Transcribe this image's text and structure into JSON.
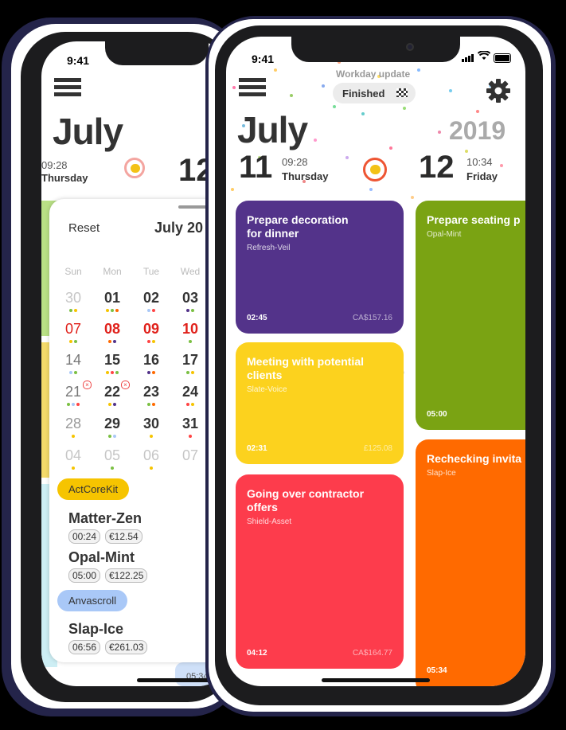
{
  "back_phone": {
    "status_time": "9:41",
    "month": "July",
    "left_time": "09:28",
    "left_weekday": "Thursday",
    "right_day": "12",
    "sheet": {
      "reset_label": "Reset",
      "month_label": "July 20",
      "weekdays": [
        "Sun",
        "Mon",
        "Tue",
        "Wed"
      ],
      "rows": [
        [
          "30",
          "01",
          "02",
          "03"
        ],
        [
          "07",
          "08",
          "09",
          "10"
        ],
        [
          "14",
          "15",
          "16",
          "17"
        ],
        [
          "21",
          "22",
          "23",
          "24"
        ],
        [
          "28",
          "29",
          "30",
          "31"
        ],
        [
          "04",
          "05",
          "06",
          "07"
        ]
      ],
      "groups": [
        {
          "name": "ActCoreKit",
          "color": "#f6c400",
          "items": [
            {
              "name": "Matter-Zen",
              "duration": "00:24",
              "amount": "€12.54"
            },
            {
              "name": "Opal-Mint",
              "duration": "05:00",
              "amount": "€122.25"
            }
          ]
        },
        {
          "name": "Anvascroll",
          "color": "#a9c8f7",
          "items": [
            {
              "name": "Slap-Ice",
              "duration": "06:56",
              "amount": "€261.03"
            }
          ]
        }
      ],
      "peek_time": "05:34"
    }
  },
  "front_phone": {
    "status_time": "9:41",
    "update_label": "Workday update",
    "finished_label": "Finished",
    "month": "July",
    "year": "2019",
    "left_day": "11",
    "left_time": "09:28",
    "left_weekday": "Thursday",
    "right_day": "12",
    "right_time": "10:34",
    "right_weekday": "Friday",
    "cards_left": [
      {
        "title": "Prepare decoration for dinner",
        "subtitle": "Refresh-Veil",
        "duration": "02:45",
        "amount": "CA$157.16",
        "color": "#53338a"
      },
      {
        "title": "Meeting with potential clients",
        "subtitle": "Slate-Voice",
        "duration": "02:31",
        "amount": "£125.08",
        "color": "#fcd21e"
      },
      {
        "title": "Going over contractor offers",
        "subtitle": "Shield-Asset",
        "duration": "04:12",
        "amount": "CA$164.77",
        "color": "#fd3c4c"
      }
    ],
    "cards_right": [
      {
        "title": "Prepare seating p",
        "subtitle": "Opal-Mint",
        "duration": "05:00",
        "color": "#7aa313"
      },
      {
        "title": "Rechecking invita",
        "subtitle": "Slap-Ice",
        "duration": "05:34",
        "color": "#ff6a00"
      }
    ]
  },
  "icons": [
    "menu-icon",
    "gear-icon",
    "lemon-timer-icon",
    "checkered-flag-icon",
    "wifi-icon",
    "battery-icon",
    "signal-icon",
    "camera-icon"
  ]
}
